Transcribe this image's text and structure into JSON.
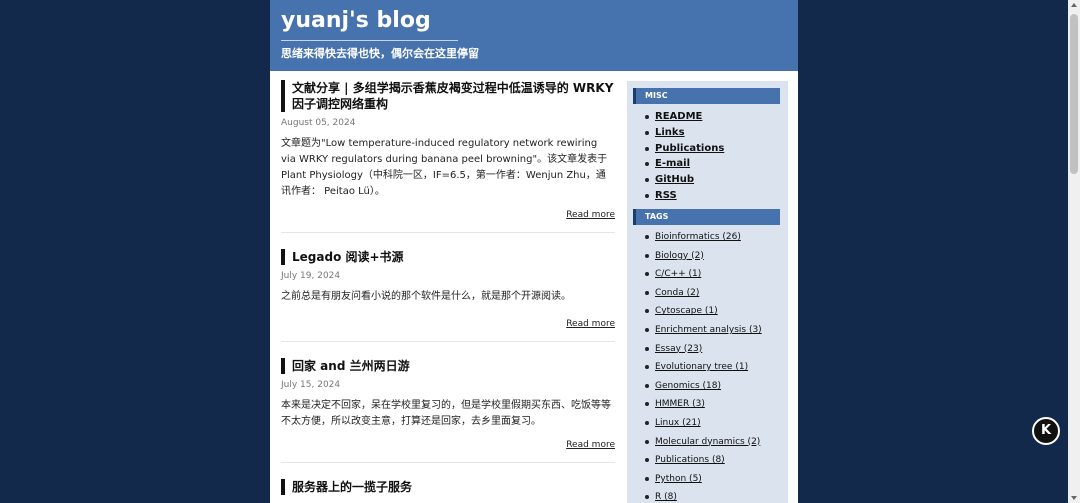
{
  "site": {
    "title": "yuanj's blog",
    "subtitle": "思绪来得快去得也快，偶尔会在这里停留"
  },
  "posts": [
    {
      "title": "文献分享 | 多组学揭示香蕉皮褐变过程中低温诱导的 WRKY 因子调控网络重构",
      "date": "August 05, 2024",
      "excerpt": "文章题为\"Low temperature-induced regulatory network rewiring via WRKY regulators during banana peel browning\"。该文章发表于 Plant Physiology（中科院一区，IF=6.5，第一作者：Wenjun Zhu，通讯作者： Peitao Lü）。",
      "read_more": "Read more"
    },
    {
      "title": "Legado 阅读+书源",
      "date": "July 19, 2024",
      "excerpt": "之前总是有朋友问看小说的那个软件是什么，就是那个开源阅读。",
      "read_more": "Read more"
    },
    {
      "title": "回家 and 兰州两日游",
      "date": "July 15, 2024",
      "excerpt": "本来是决定不回家，呆在学校里复习的，但是学校里假期买东西、吃饭等等不太方便，所以改变主意，打算还是回家，去乡里面复习。",
      "read_more": "Read more"
    },
    {
      "title": "服务器上的一揽子服务"
    }
  ],
  "sidebar": {
    "misc_heading": "MISC",
    "misc": [
      "README",
      "Links",
      "Publications",
      "E-mail",
      "GitHub",
      "RSS"
    ],
    "tags_heading": "TAGS",
    "tags": [
      "Bioinformatics (26)",
      "Biology (2)",
      "C/C++ (1)",
      "Conda (2)",
      "Cytoscape (1)",
      "Enrichment analysis (3)",
      "Essay (23)",
      "Evolutionary tree (1)",
      "Genomics (18)",
      "HMMER (3)",
      "Linux (21)",
      "Molecular dynamics (2)",
      "Publications (8)",
      "Python (5)",
      "R (8)"
    ]
  },
  "float_button": {
    "icon": "k-logo-icon",
    "label": "K"
  },
  "colors": {
    "background": "#13294b",
    "header": "#4672ad",
    "sidebar": "#dbe3ef"
  }
}
